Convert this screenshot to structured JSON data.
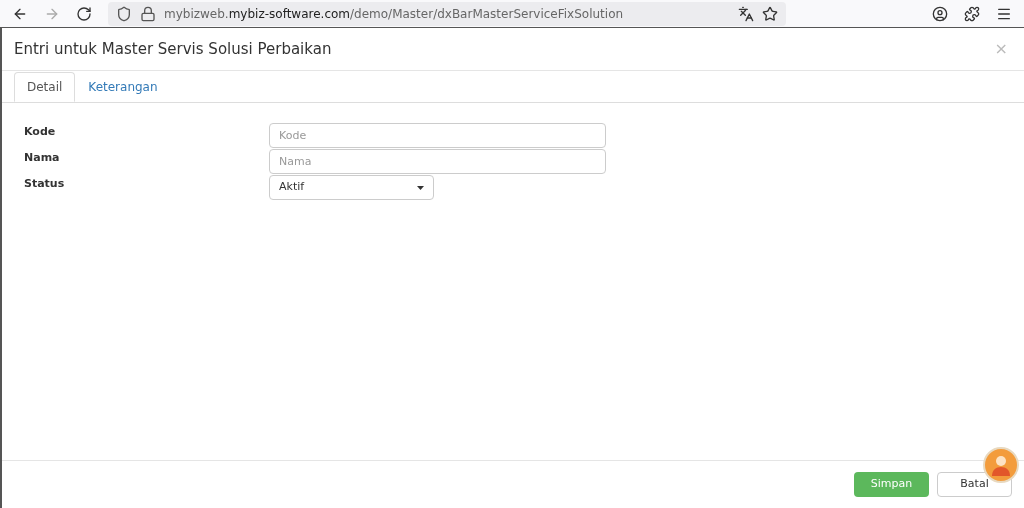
{
  "browser": {
    "url": "mybizweb.**mybiz-software.com**/demo/Master/dxBarMasterServiceFixSolution"
  },
  "modal": {
    "title": "Entri untuk Master Servis Solusi Perbaikan",
    "close": "×"
  },
  "tabs": [
    {
      "label": "Detail",
      "selected": true
    },
    {
      "label": "Keterangan",
      "selected": false
    }
  ],
  "fields": [
    {
      "kind": "text",
      "label": "Kode",
      "placeholder": "Kode"
    },
    {
      "kind": "text",
      "label": "Nama",
      "placeholder": "Nama"
    },
    {
      "kind": "select",
      "label": "Status",
      "value": "Aktif"
    }
  ],
  "buttons": [
    {
      "kind": "primary",
      "label": "Simpan"
    },
    {
      "kind": "default",
      "label": "Batal"
    }
  ]
}
